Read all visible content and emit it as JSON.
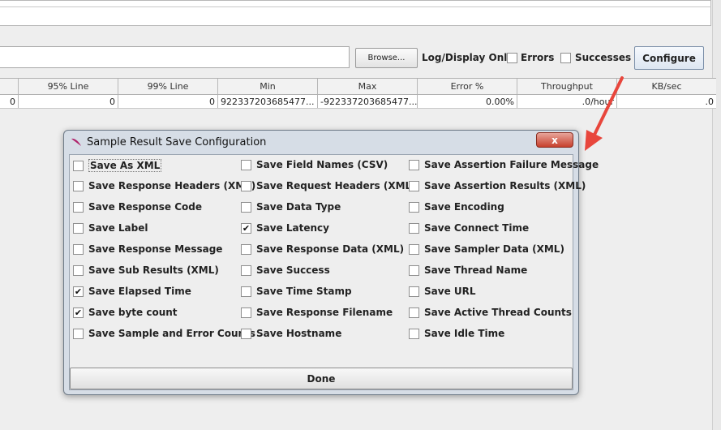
{
  "toolbar": {
    "browse_label": "Browse...",
    "log_display_label": "Log/Display Only:",
    "errors_label": "Errors",
    "successes_label": "Successes",
    "configure_label": "Configure"
  },
  "table": {
    "headers": [
      "",
      "95% Line",
      "99% Line",
      "Min",
      "Max",
      "Error %",
      "Throughput",
      "KB/sec"
    ],
    "row": [
      "0",
      "0",
      "0",
      "922337203685477...",
      "-922337203685477...",
      "0.00%",
      ".0/hour",
      ".0"
    ]
  },
  "dialog": {
    "title": "Sample Result Save Configuration",
    "close_label": "x",
    "done_label": "Done",
    "columns": [
      [
        {
          "label": "Save As XML",
          "checked": false
        },
        {
          "label": "Save Response Headers (XML)",
          "checked": false
        },
        {
          "label": "Save Response Code",
          "checked": false
        },
        {
          "label": "Save Label",
          "checked": false
        },
        {
          "label": "Save Response Message",
          "checked": false
        },
        {
          "label": "Save Sub Results (XML)",
          "checked": false
        },
        {
          "label": "Save Elapsed Time",
          "checked": true
        },
        {
          "label": "Save byte count",
          "checked": true
        },
        {
          "label": "Save Sample and Error Counts",
          "checked": false
        }
      ],
      [
        {
          "label": "Save Field Names (CSV)",
          "checked": false
        },
        {
          "label": "Save Request Headers (XML)",
          "checked": false
        },
        {
          "label": "Save Data Type",
          "checked": false
        },
        {
          "label": "Save Latency",
          "checked": true
        },
        {
          "label": "Save Response Data (XML)",
          "checked": false
        },
        {
          "label": "Save Success",
          "checked": false
        },
        {
          "label": "Save Time Stamp",
          "checked": false
        },
        {
          "label": "Save Response Filename",
          "checked": false
        },
        {
          "label": "Save Hostname",
          "checked": false
        }
      ],
      [
        {
          "label": "Save Assertion Failure Message",
          "checked": false
        },
        {
          "label": "Save Assertion Results (XML)",
          "checked": false
        },
        {
          "label": "Save Encoding",
          "checked": false
        },
        {
          "label": "Save Connect Time",
          "checked": false
        },
        {
          "label": "Save Sampler Data (XML)",
          "checked": false
        },
        {
          "label": "Save Thread Name",
          "checked": false
        },
        {
          "label": "Save URL",
          "checked": false
        },
        {
          "label": "Save Active Thread Counts",
          "checked": false
        },
        {
          "label": "Save Idle Time",
          "checked": false
        }
      ]
    ]
  },
  "colors": {
    "annotation_arrow": "#e8463c",
    "close_button": "#c7402c"
  }
}
